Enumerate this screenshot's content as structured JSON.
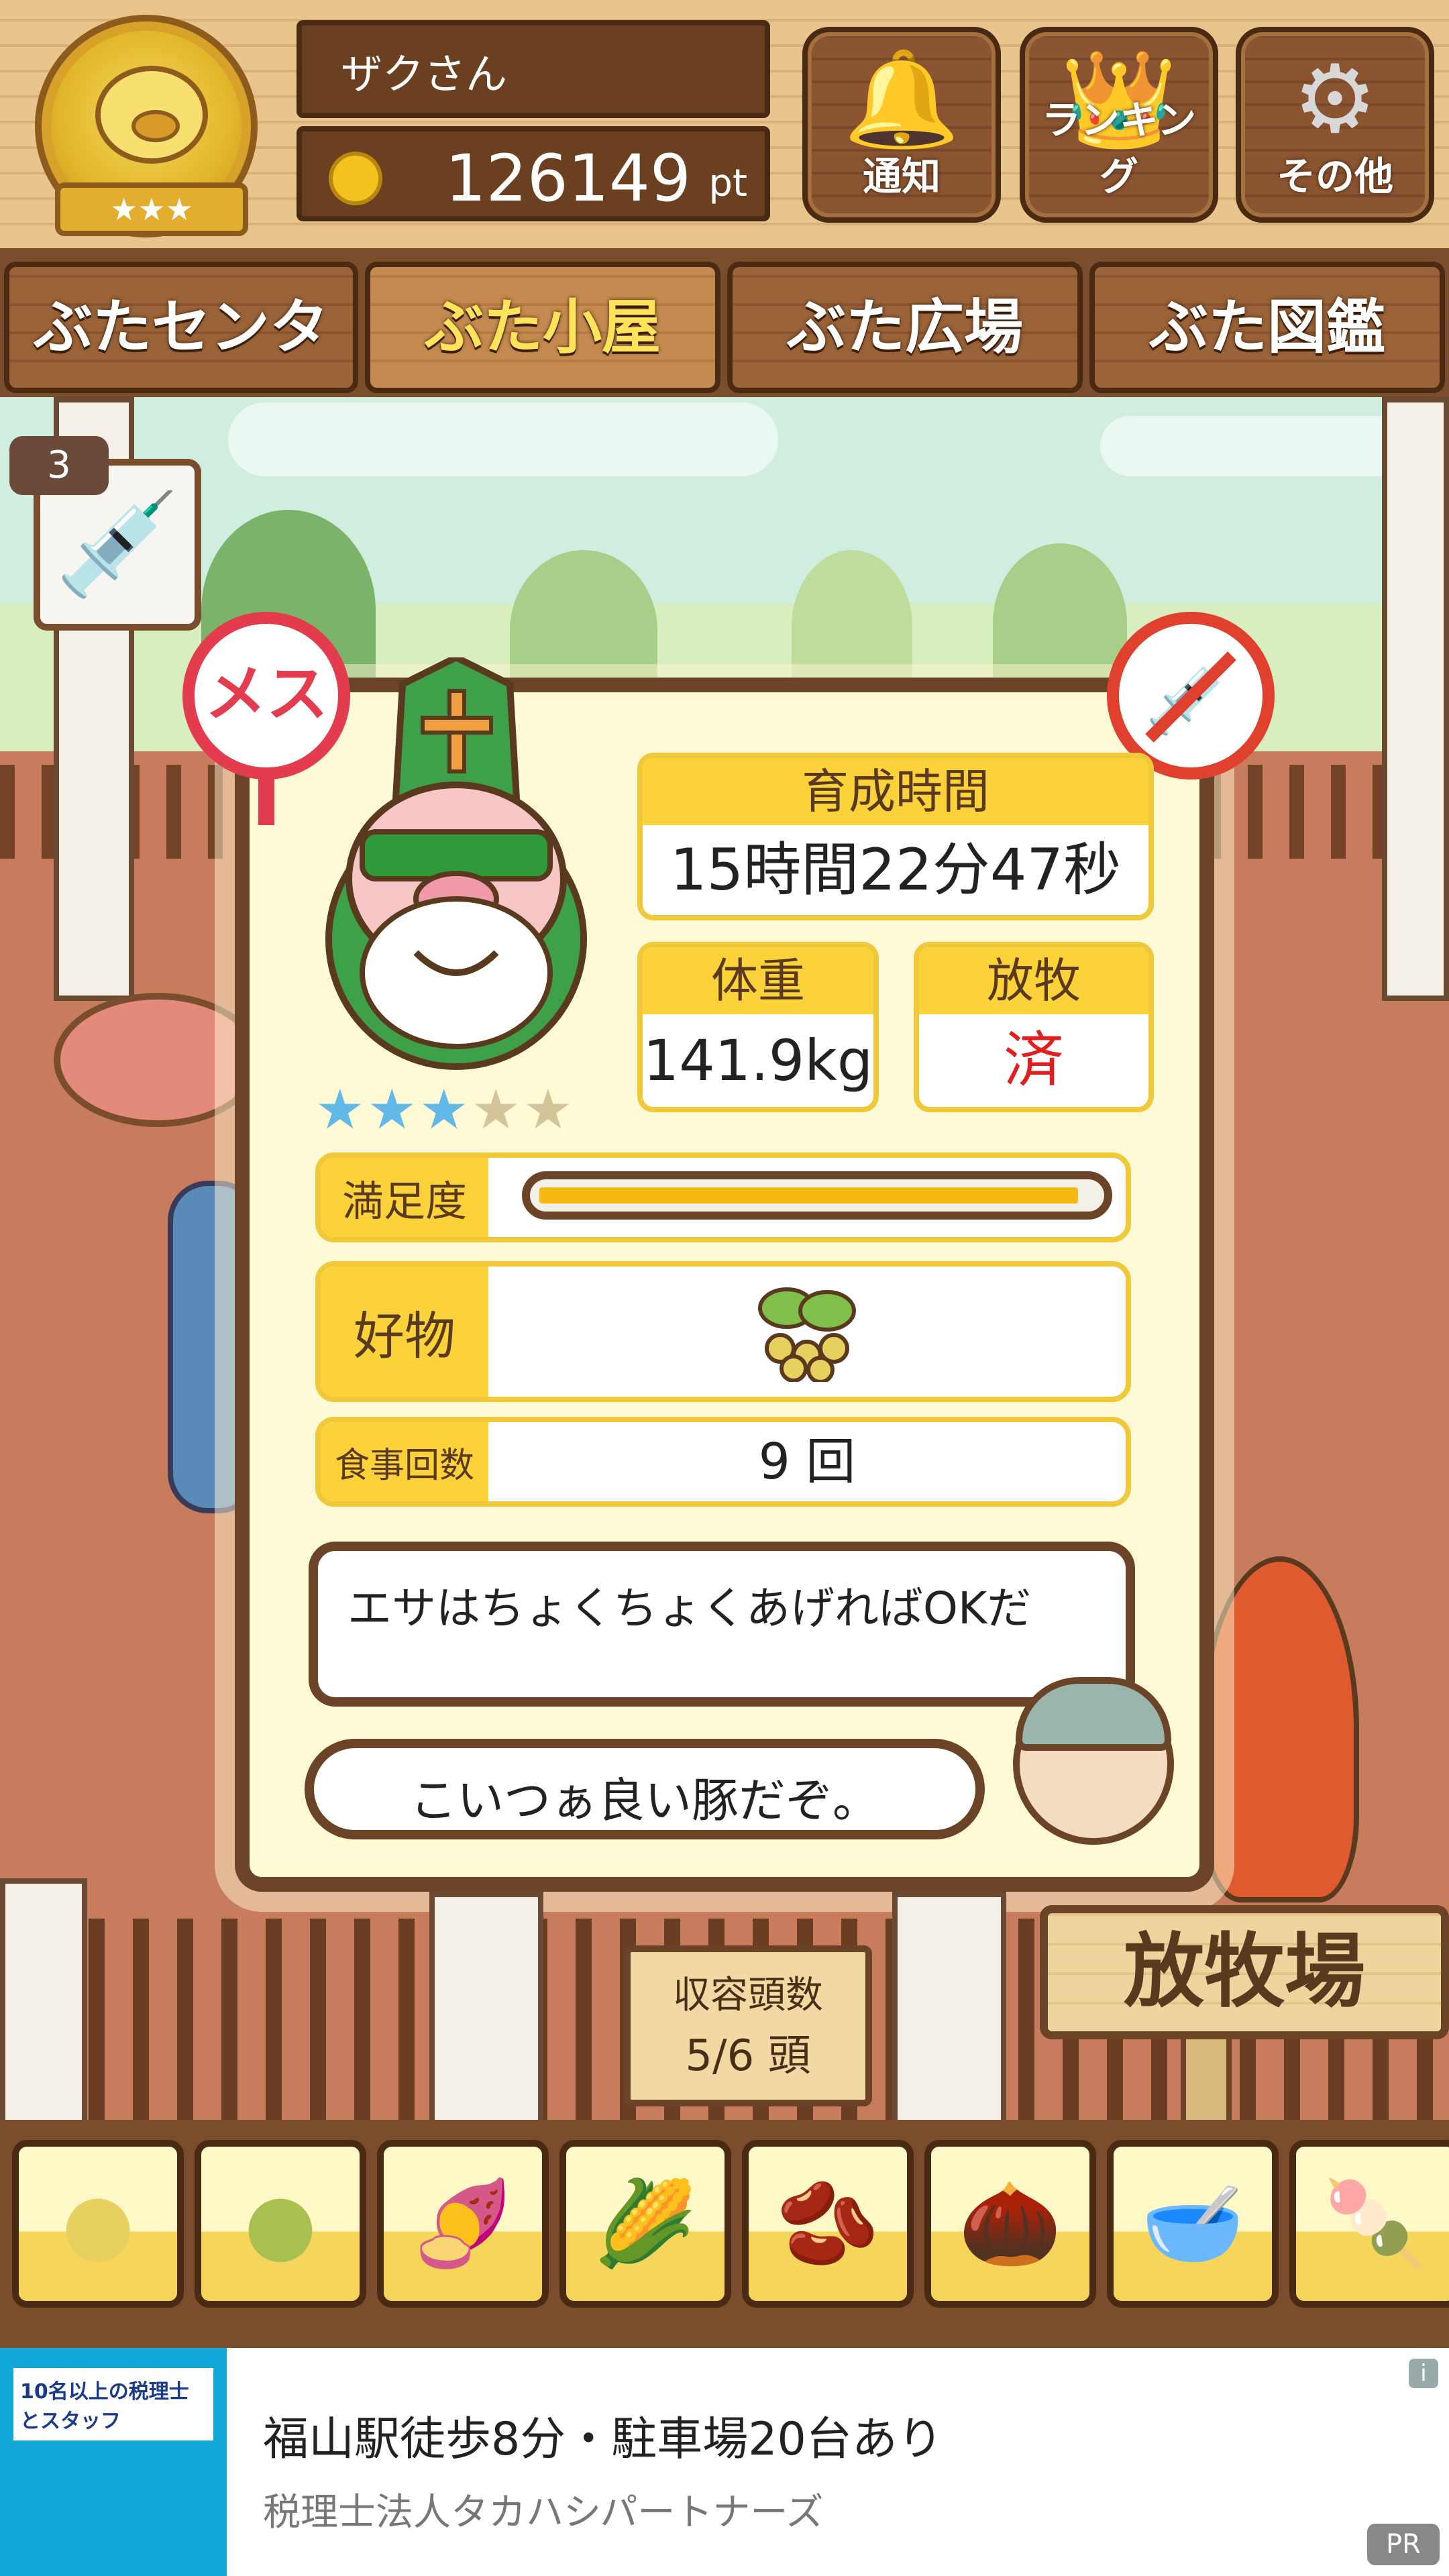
{
  "header": {
    "user_name": "ザクさん",
    "points": "126149",
    "points_unit": "pt",
    "medal_stars": "★★★",
    "buttons": [
      {
        "label": "通知",
        "icon": "bell-icon"
      },
      {
        "label": "ランキング",
        "icon": "crown-icon"
      },
      {
        "label": "その他",
        "icon": "gear-icon"
      }
    ]
  },
  "tabs": [
    {
      "label": "ぶたセンター",
      "active": false
    },
    {
      "label": "ぶた小屋",
      "active": true
    },
    {
      "label": "ぶた広場",
      "active": false
    },
    {
      "label": "ぶた図鑑",
      "active": false
    }
  ],
  "syringe": {
    "count": "3"
  },
  "pig_card": {
    "gender_badge": "メス",
    "rating": 3,
    "rating_max": 5,
    "growth_time_label": "育成時間",
    "growth_time_value": "15時間22分47秒",
    "weight_label": "体重",
    "weight_value": "141.9kg",
    "grazing_label": "放牧",
    "grazing_value": "済",
    "satisfaction_label": "満足度",
    "satisfaction_level": 0.97,
    "favorite_label": "好物",
    "favorite_icon": "soybean-icon",
    "meals_label": "食事回数",
    "meals_value": "9 回",
    "speech_1": "エサはちょくちょくあげればOKだ",
    "speech_2": "こいつぁ良い豚だぞ。"
  },
  "capacity": {
    "label": "収容頭数",
    "value": "5/6 頭"
  },
  "pasture_sign": "放牧場",
  "food_slots": [
    {
      "icon": "soybeans-icon",
      "glyph": "●"
    },
    {
      "icon": "mixed-beans-icon",
      "glyph": "●"
    },
    {
      "icon": "sweet-potato-icon",
      "glyph": "🍠"
    },
    {
      "icon": "corn-icon",
      "glyph": "🌽"
    },
    {
      "icon": "edamame-icon",
      "glyph": "🫘"
    },
    {
      "icon": "acorn-icon",
      "glyph": "🌰"
    },
    {
      "icon": "grain-bowl-icon",
      "glyph": "🥣"
    },
    {
      "icon": "meatball-plate-icon",
      "glyph": "🍡"
    }
  ],
  "ad": {
    "thumb_text": "10名以上の税理士とスタッフ",
    "title": "福山駅徒歩8分・駐車場20台あり",
    "subtitle": "税理士法人タカハシパートナーズ",
    "badge": "PR",
    "info": "i"
  },
  "colors": {
    "accent_yellow": "#fcd23a",
    "wood_brown": "#6b4428",
    "grazing_red": "#e0201e",
    "star_on": "#62b8e6"
  }
}
